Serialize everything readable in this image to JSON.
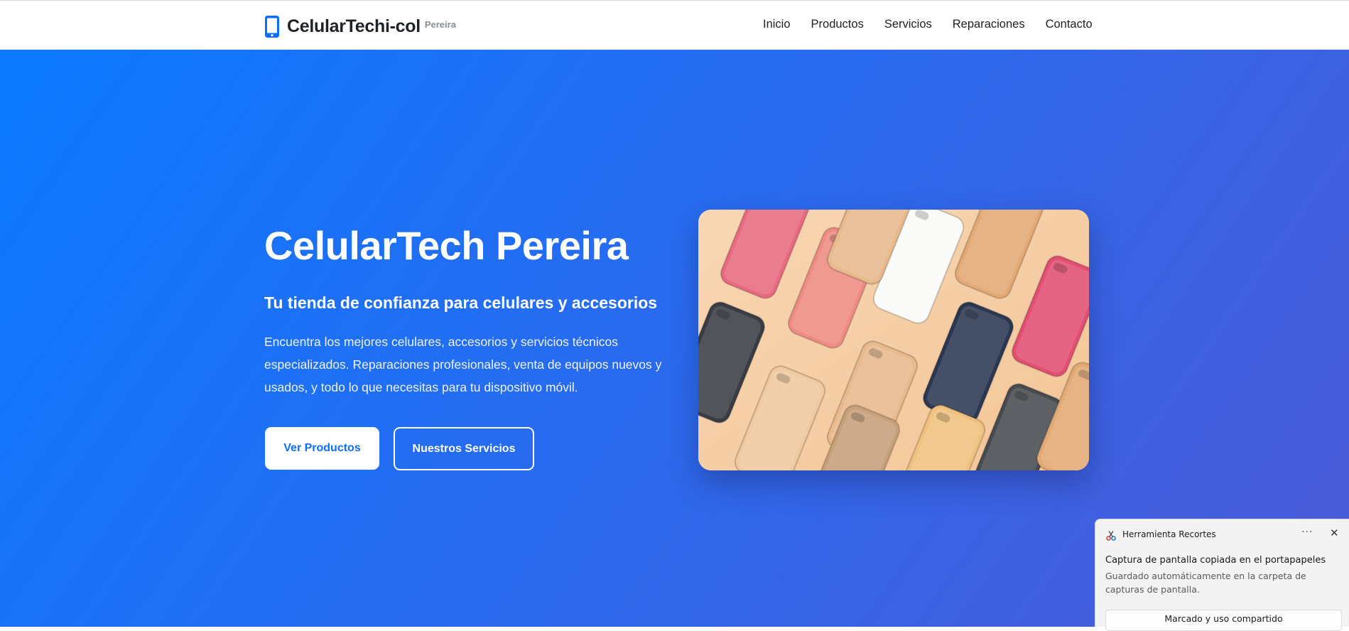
{
  "navbar": {
    "brand_name": "CelularTechi-col",
    "brand_city": "Pereira",
    "brand_icon": "smartphone-icon",
    "links": [
      "Inicio",
      "Productos",
      "Servicios",
      "Reparaciones",
      "Contacto"
    ]
  },
  "hero": {
    "title": "CelularTech Pereira",
    "subtitle": "Tu tienda de confianza para celulares y accesorios",
    "description": "Encuentra los mejores celulares, accesorios y servicios técnicos especializados. Reparaciones profesionales, venta de equipos nuevos y usados, y todo lo que necesitas para tu dispositivo móvil.",
    "primary_button": "Ver Productos",
    "secondary_button": "Nuestros Servicios",
    "image_subject": "phone-cases-photo"
  },
  "toast": {
    "app_name": "Herramienta Recortes",
    "more_icon": "···",
    "close_icon": "✕",
    "title": "Captura de pantalla copiada en el portapapeles",
    "body": "Guardado automáticamente en la carpeta de capturas de pantalla.",
    "action_label": "Marcado y uso compartido"
  },
  "colors": {
    "brand_blue": "#0d6efd",
    "hero_gradient_start": "#0a79ff",
    "hero_gradient_end": "#4c59d6",
    "case_colors": [
      "#e86a80",
      "#ee8b82",
      "#fafaf7",
      "#e3a975",
      "#3a3d44",
      "#efc9a0",
      "#e8b98c",
      "#2c3852",
      "#e24f72",
      "#474a4f",
      "#f0c17e",
      "#c7a07a"
    ]
  }
}
